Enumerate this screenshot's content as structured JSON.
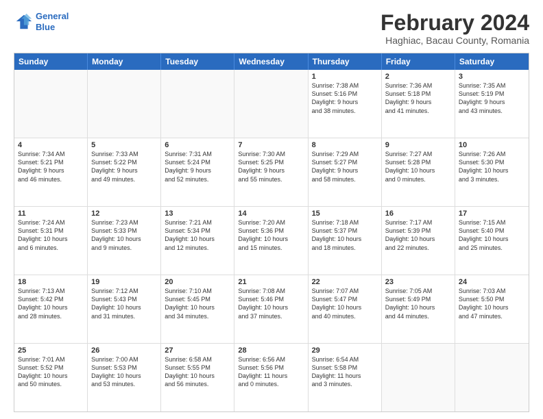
{
  "logo": {
    "line1": "General",
    "line2": "Blue"
  },
  "title": "February 2024",
  "subtitle": "Haghiac, Bacau County, Romania",
  "header_days": [
    "Sunday",
    "Monday",
    "Tuesday",
    "Wednesday",
    "Thursday",
    "Friday",
    "Saturday"
  ],
  "rows": [
    [
      {
        "day": "",
        "text": ""
      },
      {
        "day": "",
        "text": ""
      },
      {
        "day": "",
        "text": ""
      },
      {
        "day": "",
        "text": ""
      },
      {
        "day": "1",
        "text": "Sunrise: 7:38 AM\nSunset: 5:16 PM\nDaylight: 9 hours\nand 38 minutes."
      },
      {
        "day": "2",
        "text": "Sunrise: 7:36 AM\nSunset: 5:18 PM\nDaylight: 9 hours\nand 41 minutes."
      },
      {
        "day": "3",
        "text": "Sunrise: 7:35 AM\nSunset: 5:19 PM\nDaylight: 9 hours\nand 43 minutes."
      }
    ],
    [
      {
        "day": "4",
        "text": "Sunrise: 7:34 AM\nSunset: 5:21 PM\nDaylight: 9 hours\nand 46 minutes."
      },
      {
        "day": "5",
        "text": "Sunrise: 7:33 AM\nSunset: 5:22 PM\nDaylight: 9 hours\nand 49 minutes."
      },
      {
        "day": "6",
        "text": "Sunrise: 7:31 AM\nSunset: 5:24 PM\nDaylight: 9 hours\nand 52 minutes."
      },
      {
        "day": "7",
        "text": "Sunrise: 7:30 AM\nSunset: 5:25 PM\nDaylight: 9 hours\nand 55 minutes."
      },
      {
        "day": "8",
        "text": "Sunrise: 7:29 AM\nSunset: 5:27 PM\nDaylight: 9 hours\nand 58 minutes."
      },
      {
        "day": "9",
        "text": "Sunrise: 7:27 AM\nSunset: 5:28 PM\nDaylight: 10 hours\nand 0 minutes."
      },
      {
        "day": "10",
        "text": "Sunrise: 7:26 AM\nSunset: 5:30 PM\nDaylight: 10 hours\nand 3 minutes."
      }
    ],
    [
      {
        "day": "11",
        "text": "Sunrise: 7:24 AM\nSunset: 5:31 PM\nDaylight: 10 hours\nand 6 minutes."
      },
      {
        "day": "12",
        "text": "Sunrise: 7:23 AM\nSunset: 5:33 PM\nDaylight: 10 hours\nand 9 minutes."
      },
      {
        "day": "13",
        "text": "Sunrise: 7:21 AM\nSunset: 5:34 PM\nDaylight: 10 hours\nand 12 minutes."
      },
      {
        "day": "14",
        "text": "Sunrise: 7:20 AM\nSunset: 5:36 PM\nDaylight: 10 hours\nand 15 minutes."
      },
      {
        "day": "15",
        "text": "Sunrise: 7:18 AM\nSunset: 5:37 PM\nDaylight: 10 hours\nand 18 minutes."
      },
      {
        "day": "16",
        "text": "Sunrise: 7:17 AM\nSunset: 5:39 PM\nDaylight: 10 hours\nand 22 minutes."
      },
      {
        "day": "17",
        "text": "Sunrise: 7:15 AM\nSunset: 5:40 PM\nDaylight: 10 hours\nand 25 minutes."
      }
    ],
    [
      {
        "day": "18",
        "text": "Sunrise: 7:13 AM\nSunset: 5:42 PM\nDaylight: 10 hours\nand 28 minutes."
      },
      {
        "day": "19",
        "text": "Sunrise: 7:12 AM\nSunset: 5:43 PM\nDaylight: 10 hours\nand 31 minutes."
      },
      {
        "day": "20",
        "text": "Sunrise: 7:10 AM\nSunset: 5:45 PM\nDaylight: 10 hours\nand 34 minutes."
      },
      {
        "day": "21",
        "text": "Sunrise: 7:08 AM\nSunset: 5:46 PM\nDaylight: 10 hours\nand 37 minutes."
      },
      {
        "day": "22",
        "text": "Sunrise: 7:07 AM\nSunset: 5:47 PM\nDaylight: 10 hours\nand 40 minutes."
      },
      {
        "day": "23",
        "text": "Sunrise: 7:05 AM\nSunset: 5:49 PM\nDaylight: 10 hours\nand 44 minutes."
      },
      {
        "day": "24",
        "text": "Sunrise: 7:03 AM\nSunset: 5:50 PM\nDaylight: 10 hours\nand 47 minutes."
      }
    ],
    [
      {
        "day": "25",
        "text": "Sunrise: 7:01 AM\nSunset: 5:52 PM\nDaylight: 10 hours\nand 50 minutes."
      },
      {
        "day": "26",
        "text": "Sunrise: 7:00 AM\nSunset: 5:53 PM\nDaylight: 10 hours\nand 53 minutes."
      },
      {
        "day": "27",
        "text": "Sunrise: 6:58 AM\nSunset: 5:55 PM\nDaylight: 10 hours\nand 56 minutes."
      },
      {
        "day": "28",
        "text": "Sunrise: 6:56 AM\nSunset: 5:56 PM\nDaylight: 11 hours\nand 0 minutes."
      },
      {
        "day": "29",
        "text": "Sunrise: 6:54 AM\nSunset: 5:58 PM\nDaylight: 11 hours\nand 3 minutes."
      },
      {
        "day": "",
        "text": ""
      },
      {
        "day": "",
        "text": ""
      }
    ]
  ]
}
